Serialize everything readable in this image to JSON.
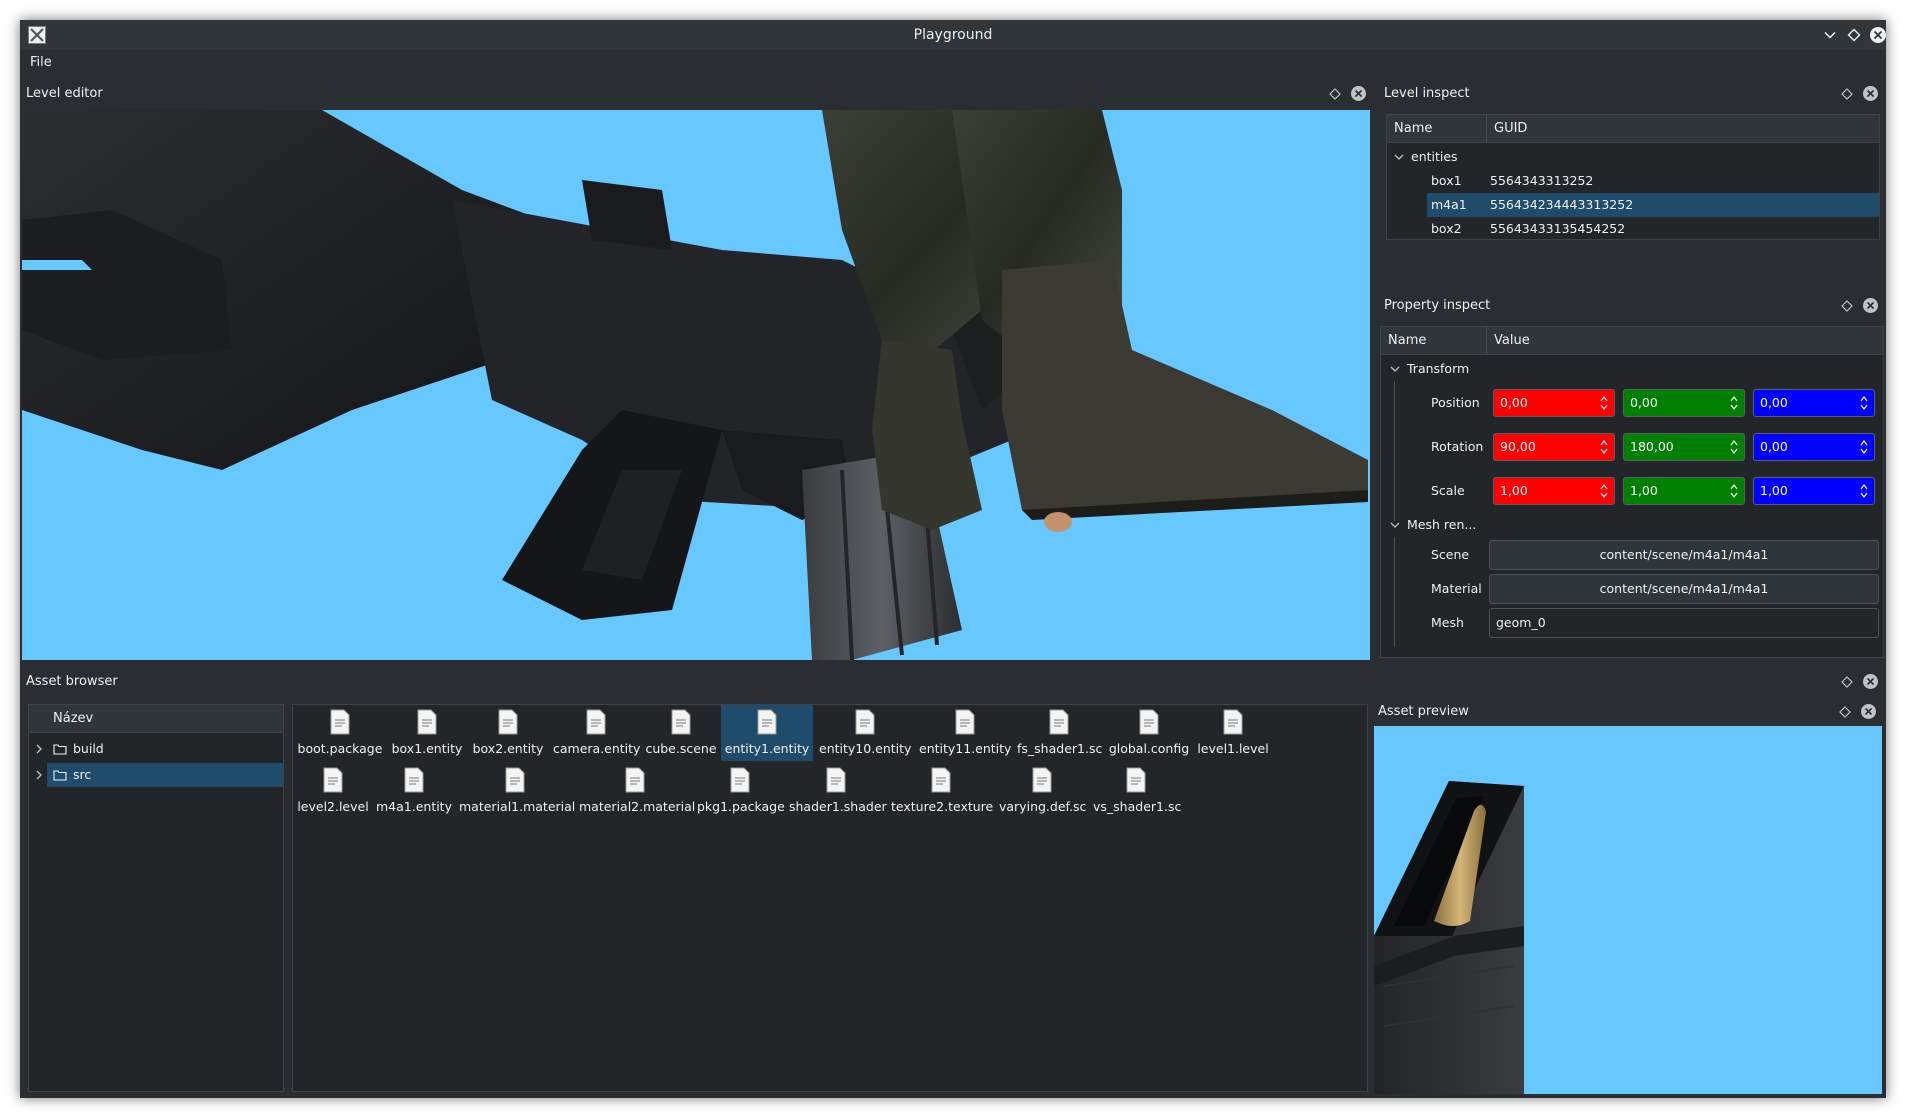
{
  "window": {
    "title": "Playground"
  },
  "menu": {
    "file": "File"
  },
  "level_editor": {
    "title": "Level editor"
  },
  "level_inspect": {
    "title": "Level inspect",
    "columns": [
      "Name",
      "GUID"
    ],
    "group": "entities",
    "rows": [
      {
        "name": "box1",
        "guid": "5564343313252"
      },
      {
        "name": "m4a1",
        "guid": "556434234443313252"
      },
      {
        "name": "box2",
        "guid": "55643433135454252"
      }
    ],
    "selected": "m4a1"
  },
  "property_inspect": {
    "title": "Property inspect",
    "columns": [
      "Name",
      "Value"
    ],
    "transform": {
      "label": "Transform",
      "position": {
        "label": "Position",
        "x": "0,00",
        "y": "0,00",
        "z": "0,00"
      },
      "rotation": {
        "label": "Rotation",
        "x": "90,00",
        "y": "180,00",
        "z": "0,00"
      },
      "scale": {
        "label": "Scale",
        "x": "1,00",
        "y": "1,00",
        "z": "1,00"
      }
    },
    "mesh_renderer": {
      "label": "Mesh ren...",
      "scene": {
        "label": "Scene",
        "value": "content/scene/m4a1/m4a1"
      },
      "material": {
        "label": "Material",
        "value": "content/scene/m4a1/m4a1"
      },
      "mesh": {
        "label": "Mesh",
        "value": "geom_0"
      }
    }
  },
  "asset_browser": {
    "title": "Asset browser",
    "tree_header": "Název",
    "tree": [
      {
        "label": "build"
      },
      {
        "label": "src"
      }
    ],
    "selected_folder": "src",
    "files_row1": [
      "boot.package",
      "box1.entity",
      "box2.entity",
      "camera.entity",
      "cube.scene",
      "entity1.entity",
      "entity10.entity",
      "entity11.entity",
      "fs_shader1.sc",
      "global.config",
      "level1.level"
    ],
    "files_row2": [
      "level2.level",
      "m4a1.entity",
      "material1.material",
      "material2.material",
      "pkg1.package",
      "shader1.shader",
      "texture2.texture",
      "varying.def.sc",
      "vs_shader1.sc"
    ],
    "selected_file": "entity1.entity"
  },
  "asset_preview": {
    "title": "Asset preview"
  },
  "colors": {
    "viewport_sky": "#66c8ff",
    "selection": "#1f4c6b",
    "axis_x": "#ff0000",
    "axis_y": "#008000",
    "axis_z": "#0000ff"
  }
}
